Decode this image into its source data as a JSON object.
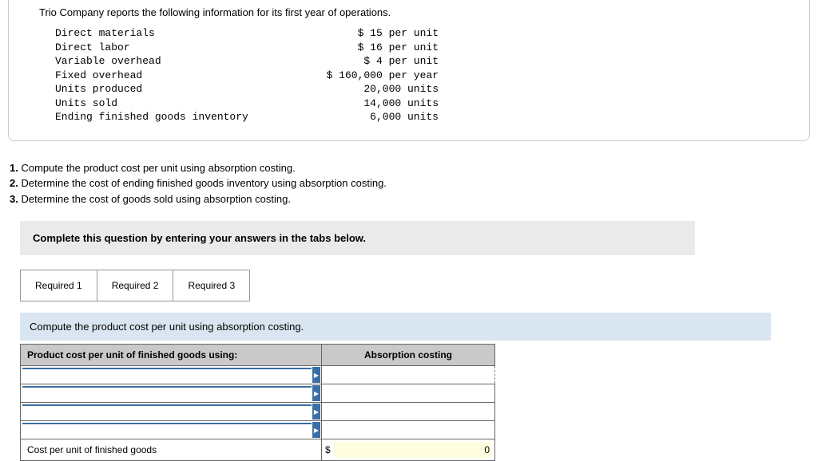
{
  "intro": "Trio Company reports the following information for its first year of operations.",
  "info_rows": [
    {
      "label": "Direct materials",
      "value": "$ 15 per unit"
    },
    {
      "label": "Direct labor",
      "value": "$ 16 per unit"
    },
    {
      "label": "Variable overhead",
      "value": "$ 4 per unit"
    },
    {
      "label": "Fixed overhead",
      "value": "$ 160,000 per year"
    },
    {
      "label": "Units produced",
      "value": "20,000 units"
    },
    {
      "label": "Units sold",
      "value": "14,000 units"
    },
    {
      "label": "Ending finished goods inventory",
      "value": "6,000 units"
    }
  ],
  "questions": {
    "q1": "Compute the product cost per unit using absorption costing.",
    "q2": "Determine the cost of ending finished goods inventory using absorption costing.",
    "q3": "Determine the cost of goods sold using absorption costing."
  },
  "prompt": "Complete this question by entering your answers in the tabs below.",
  "tabs": {
    "t1": "Required 1",
    "t2": "Required 2",
    "t3": "Required 3"
  },
  "sub_prompt": "Compute the product cost per unit using absorption costing.",
  "table": {
    "header_left": "Product cost per unit of finished goods using:",
    "header_right": "Absorption costing",
    "footer_label": "Cost per unit of finished goods",
    "currency": "$",
    "footer_value": "0"
  }
}
